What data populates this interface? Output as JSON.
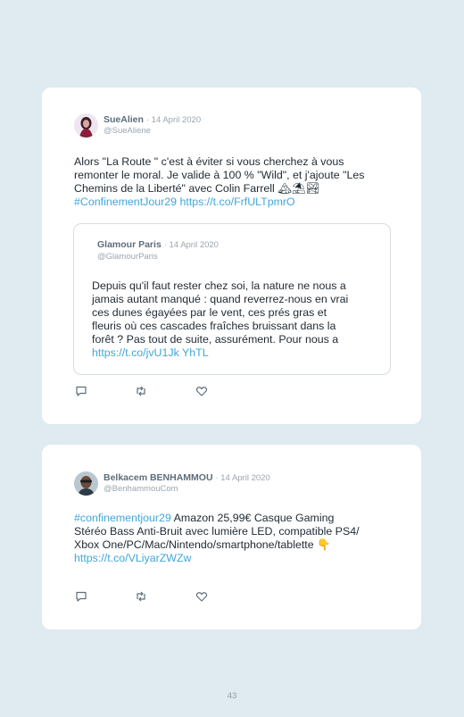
{
  "tweets": [
    {
      "author": "SueAlien",
      "date": "· 14 April 2020",
      "handle": "@SueAliene",
      "text_lines": [
        "Alors \"La Route \" c'est à éviter si vous cherchez à vous",
        "remonter le moral. Je valide à 100 % \"Wild\", et j'ajoute \"Les",
        "Chemins de la Liberté\" avec Colin Farrell 🏔⛱🏞"
      ],
      "hashtag": "#ConfinementJour29",
      "url": "https://t.co/FrfULTpmrO",
      "quote": {
        "author": "Glamour Paris",
        "date": "· 14 April 2020",
        "handle": "@GlamourParis",
        "text_lines": [
          "Depuis qu'il faut rester chez soi, la nature ne nous a",
          "jamais autant manqué : quand reverrez-nous en vrai",
          "ces dunes égayées par le vent, ces prés gras et",
          "fleuris où ces cascades fraîches bruissant dans la",
          "forêt ? Pas tout de suite, assurément. Pour nous a"
        ],
        "url": "https://t.co/jvU1Jk YhTL"
      }
    },
    {
      "author": "Belkacem BENHAMMOU",
      "date": "· 14 April 2020",
      "handle": "@BenhammouCom",
      "hashtag": "#confinementjour29",
      "text_lines": [
        " Amazon 25,99€ Casque Gaming",
        "Stéréo Bass Anti-Bruit avec lumière LED, compatible PS4/",
        "Xbox One/PC/Mac/Nintendo/smartphone/tablette 👇"
      ],
      "url": "https://t.co/VLiyarZWZw"
    }
  ],
  "icons": [
    "reply-icon",
    "retweet-icon",
    "like-icon"
  ],
  "colors": {
    "background": "#dfeaf1",
    "link": "#3fa7da",
    "text": "#1f2a33"
  },
  "page_number": "43"
}
